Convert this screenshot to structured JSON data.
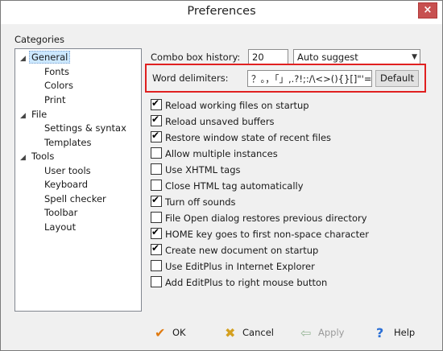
{
  "window": {
    "title": "Preferences",
    "close_glyph": "×"
  },
  "categories_label": "Categories",
  "tree": {
    "general": {
      "label": "General",
      "arrow": "◢",
      "children": [
        "Fonts",
        "Colors",
        "Print"
      ]
    },
    "file": {
      "label": "File",
      "arrow": "◢",
      "children": [
        "Settings & syntax",
        "Templates"
      ]
    },
    "tools": {
      "label": "Tools",
      "arrow": "◢",
      "children": [
        "User tools",
        "Keyboard",
        "Spell checker",
        "Toolbar",
        "Layout"
      ]
    }
  },
  "combo_history": {
    "label": "Combo box history:",
    "value": "20",
    "mode": "Auto suggest"
  },
  "word_delimiters": {
    "label": "Word delimiters:",
    "value": "？。，「」,.?!;:/\\<>(){}[]\"'=",
    "default_button": "Default"
  },
  "options": [
    {
      "label": "Reload working files on startup",
      "checked": true
    },
    {
      "label": "Reload unsaved buffers",
      "checked": true
    },
    {
      "label": "Restore window state of recent files",
      "checked": true
    },
    {
      "label": "Allow multiple instances",
      "checked": false
    },
    {
      "label": "Use XHTML tags",
      "checked": false
    },
    {
      "label": "Close HTML tag automatically",
      "checked": false
    },
    {
      "label": "Turn off sounds",
      "checked": true
    },
    {
      "label": "File Open dialog restores previous directory",
      "checked": false
    },
    {
      "label": "HOME key goes to first non-space character",
      "checked": true
    },
    {
      "label": "Create new document on startup",
      "checked": true
    },
    {
      "label": "Use EditPlus in Internet Explorer",
      "checked": false
    },
    {
      "label": "Add EditPlus to right mouse button",
      "checked": false
    }
  ],
  "footer": {
    "ok": "OK",
    "cancel": "Cancel",
    "apply": "Apply",
    "help": "Help"
  },
  "colors": {
    "ok_icon": "#e07a10",
    "cancel_icon": "#d4a020",
    "apply_icon": "#9ab89a",
    "help_icon": "#2a6fd6",
    "highlight": "#e02020"
  }
}
